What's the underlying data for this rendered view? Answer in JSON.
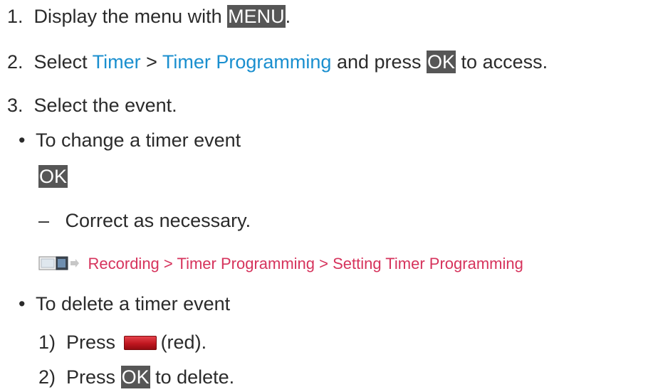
{
  "steps": [
    {
      "num": "1.",
      "pre": "Display the menu with ",
      "key": "MENU",
      "post": "."
    },
    {
      "num": "2.",
      "pre": "Select ",
      "link1": "Timer",
      "sep": " > ",
      "link2": "Timer Programming",
      "mid": " and press ",
      "key": "OK",
      "post": " to access."
    },
    {
      "num": "3.",
      "text": "Select the event."
    }
  ],
  "change": {
    "bullet": "•",
    "text": "To change a timer event",
    "key": "OK",
    "dash": "–",
    "sub": "Correct as necessary.",
    "arrow": "⇒",
    "ref": "Recording > Timer Programming > Setting Timer Programming",
    "ref_icon": "ehelp-book-icon"
  },
  "delete": {
    "bullet": "•",
    "text": "To delete a timer event",
    "step1_num": "1)",
    "step1_pre": "Press ",
    "step1_post": "(red).",
    "button_color": "red",
    "step2_num": "2)",
    "step2_pre": "Press ",
    "step2_key": "OK",
    "step2_post": " to delete."
  },
  "colors": {
    "link": "#1a8fcf",
    "ref": "#d6335c",
    "key_bg": "#565656"
  }
}
